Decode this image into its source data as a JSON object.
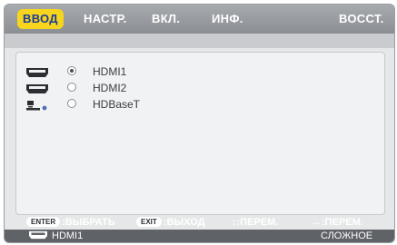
{
  "tabs": [
    {
      "label": "ВВОД",
      "active": true
    },
    {
      "label": "НАСТР.",
      "active": false
    },
    {
      "label": "ВКЛ.",
      "active": false
    },
    {
      "label": "ИНФ.",
      "active": false
    },
    {
      "label": "ВОССТ.",
      "active": false
    }
  ],
  "inputs": [
    {
      "label": "HDMI1",
      "icon": "hdmi-icon",
      "selected": true
    },
    {
      "label": "HDMI2",
      "icon": "hdmi-icon",
      "selected": false
    },
    {
      "label": "HDBaseT",
      "icon": "hdbaset-icon",
      "selected": false
    }
  ],
  "footer": {
    "enter_key": "ENTER",
    "enter_action": ":ВЫБРАТЬ",
    "exit_key": "EXIT",
    "exit_action": ":ВЫХОД",
    "updown_hint": "↕:ПЕРЕМ.",
    "leftright_hint": "↔:ПЕРЕМ."
  },
  "status": {
    "current_input": "HDMI1",
    "mode": "СЛОЖНОЕ"
  },
  "colors": {
    "active_tab_bg": "#f7d51d",
    "active_tab_text": "#1b3b9c",
    "menu_bar": "#96999d"
  }
}
